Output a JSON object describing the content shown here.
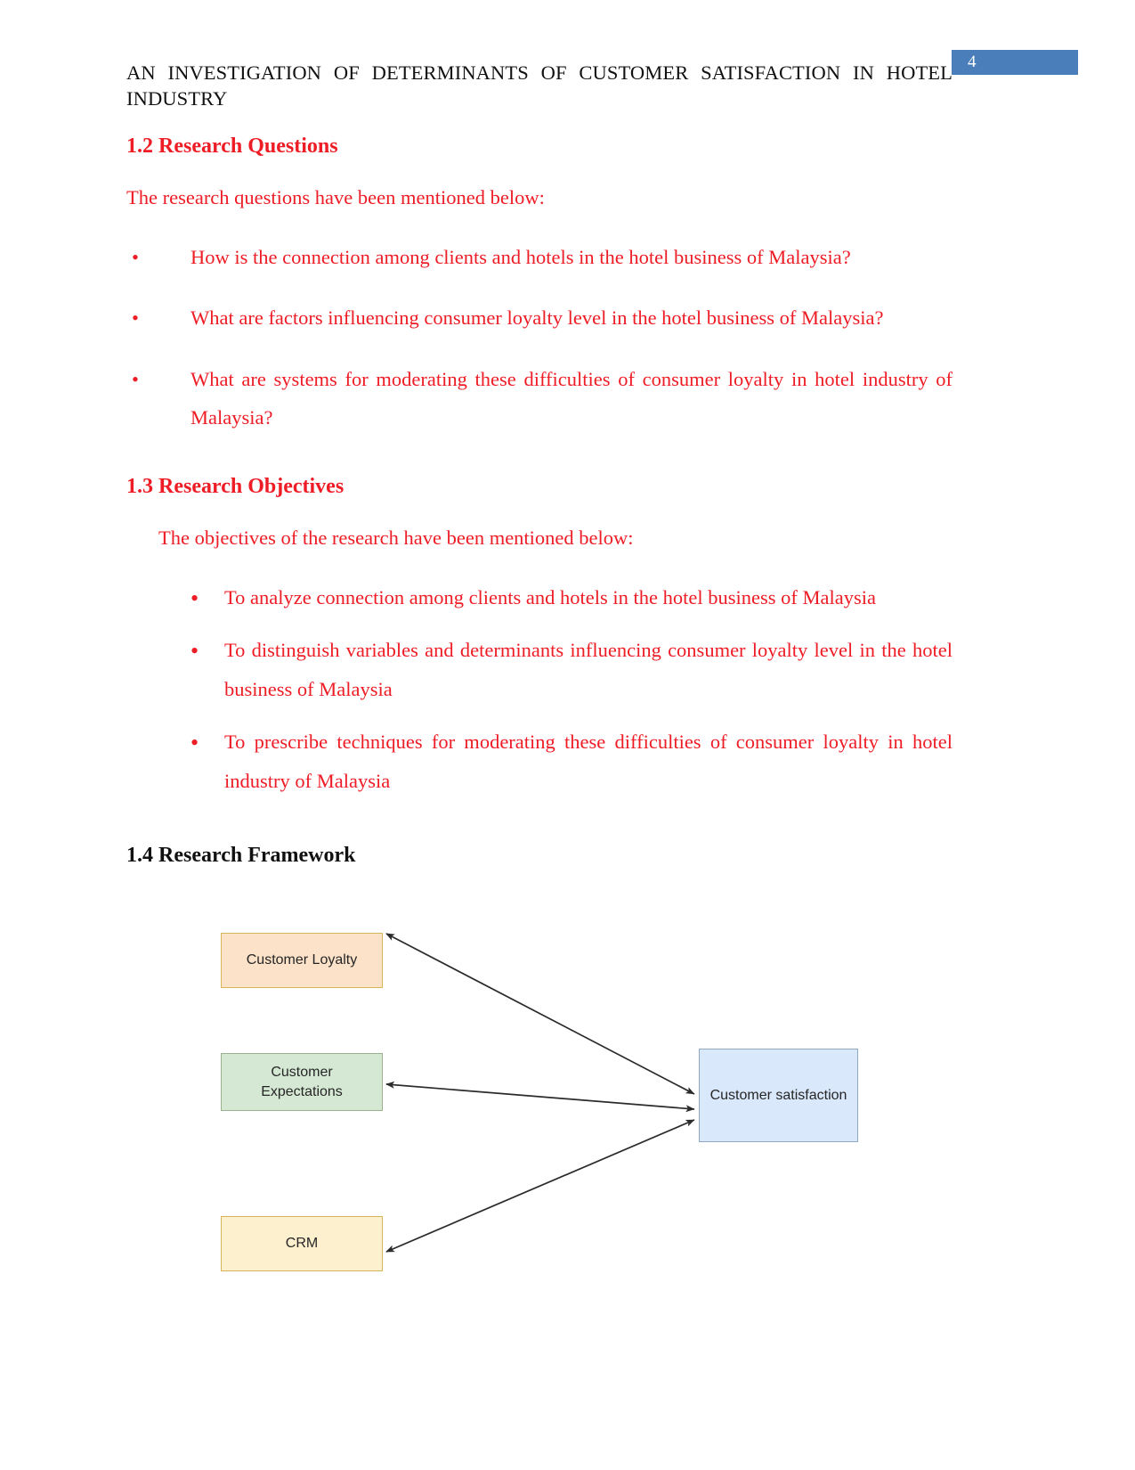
{
  "page": {
    "number": "4"
  },
  "header": {
    "running_title": "AN INVESTIGATION OF DETERMINANTS OF CUSTOMER SATISFACTION IN HOTEL INDUSTRY"
  },
  "sections": {
    "research_questions": {
      "heading": "1.2 Research Questions",
      "intro": "The research questions have been mentioned below:",
      "bullet_marker": "•",
      "items": [
        "How is the connection among clients and hotels in the hotel business of Malaysia?",
        "What are factors influencing consumer loyalty level in the hotel business of Malaysia?",
        "What are systems for moderating these difficulties of consumer loyalty in hotel industry of Malaysia?"
      ]
    },
    "research_objectives": {
      "heading": "1.3 Research Objectives",
      "intro": "The objectives of the research have been mentioned below:",
      "bullet_marker": "•",
      "items": [
        "To analyze connection among clients and hotels in the hotel business of Malaysia",
        "To distinguish variables and determinants influencing consumer loyalty level in the hotel business of Malaysia",
        "To prescribe techniques for moderating these difficulties of consumer loyalty in hotel industry of Malaysia"
      ]
    },
    "research_framework": {
      "heading": "1.4 Research Framework"
    }
  },
  "diagram": {
    "nodes": [
      {
        "id": "customer-loyalty",
        "label": "Customer Loyalty",
        "fill": "#fbe2c8",
        "stroke": "#d6b656"
      },
      {
        "id": "customer-expectations",
        "label": "Customer\nExpectations",
        "label_line1": "Customer",
        "label_line2": "Expectations",
        "fill": "#d5e8d4",
        "stroke": "#82b366"
      },
      {
        "id": "crm",
        "label": "CRM",
        "fill": "#fff2cc",
        "stroke": "#d6b656"
      },
      {
        "id": "customer-satisfaction",
        "label": "Customer satisfaction",
        "fill": "#dae8fc",
        "stroke": "#6c8ebf"
      }
    ],
    "edges": [
      {
        "from": "customer-satisfaction",
        "to": "customer-loyalty",
        "style": "double-arrow"
      },
      {
        "from": "customer-satisfaction",
        "to": "customer-expectations",
        "style": "double-arrow"
      },
      {
        "from": "customer-satisfaction",
        "to": "crm",
        "style": "double-arrow"
      }
    ],
    "edge_color": "#2b2b2b"
  },
  "colors": {
    "accent_red": "#ee1c25",
    "badge_blue": "#4a7ebb",
    "text_black": "#111111"
  }
}
